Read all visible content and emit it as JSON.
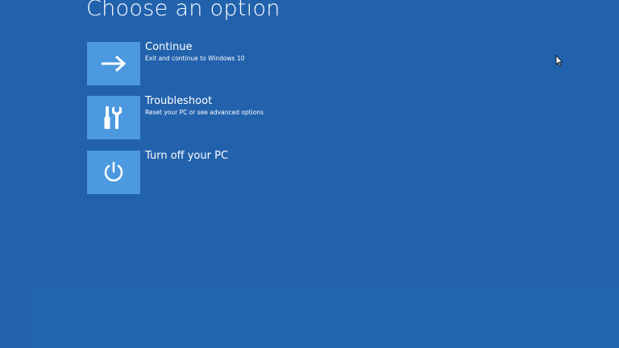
{
  "page": {
    "title": "Choose an option"
  },
  "options": [
    {
      "label": "Continue",
      "description": "Exit and continue to Windows 10",
      "icon": "arrow-right-icon"
    },
    {
      "label": "Troubleshoot",
      "description": "Reset your PC or see advanced options",
      "icon": "tools-icon"
    },
    {
      "label": "Turn off your PC",
      "description": "",
      "icon": "power-icon"
    }
  ],
  "colors": {
    "background": "#2262ad",
    "tile": "#4d99e0",
    "text": "#ffffff"
  }
}
